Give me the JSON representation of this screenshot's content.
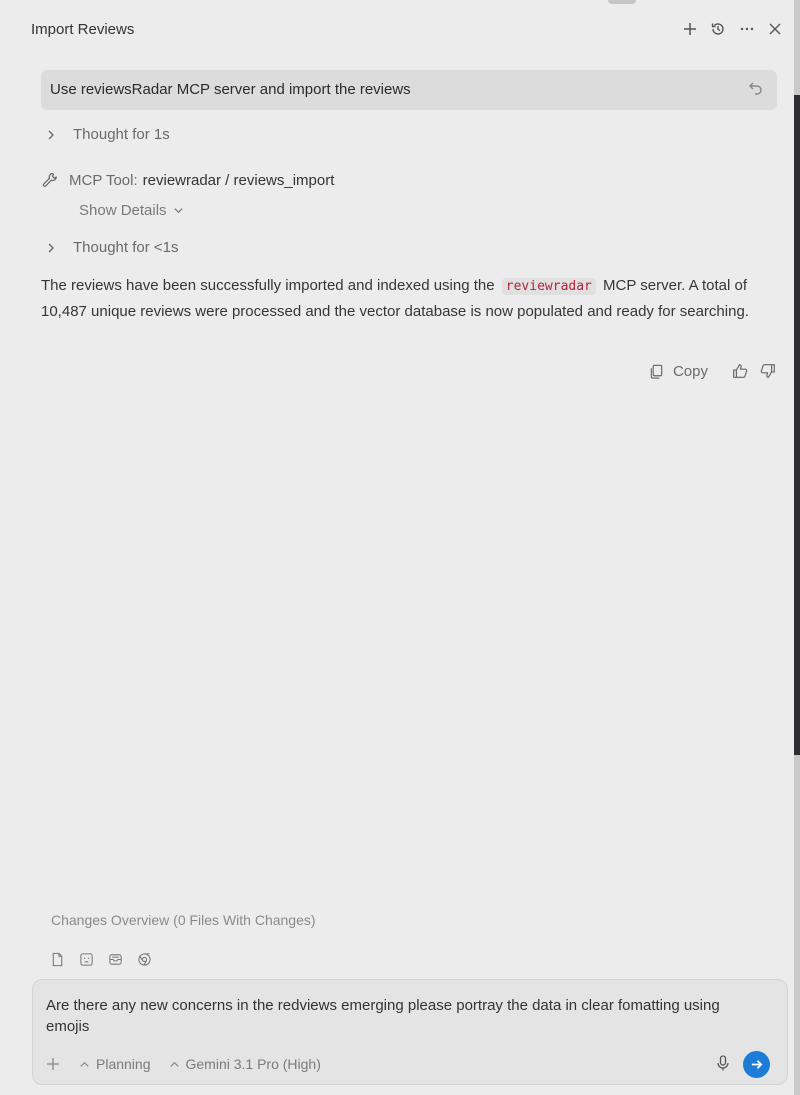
{
  "window": {
    "title": "Import Reviews"
  },
  "header_icons": [
    "plus-icon",
    "history-icon",
    "more-icon",
    "close-icon"
  ],
  "conversation": {
    "user_message": "Use reviewsRadar MCP server and import the reviews",
    "thought_1": "Thought for 1s",
    "tool": {
      "label": "MCP Tool:",
      "name": "reviewradar / reviews_import",
      "details_label": "Show Details"
    },
    "thought_2": "Thought for <1s",
    "answer": {
      "before": "The reviews have been successfully imported and indexed using the",
      "code": "reviewradar",
      "after": "MCP server. A total of 10,487 unique reviews were processed and the vector database is now populated and ready for searching."
    },
    "actions": {
      "copy_label": "Copy"
    }
  },
  "changes_overview": "Changes Overview (0 Files With Changes)",
  "composer": {
    "text": "Are there any new concerns in the redviews emerging please portray the data in clear fomatting using emojis",
    "mode": "Planning",
    "model": "Gemini 3.1 Pro (High)"
  },
  "colors": {
    "accent": "#1c7cd6",
    "code_text": "#b5233b",
    "background": "#ececec"
  }
}
